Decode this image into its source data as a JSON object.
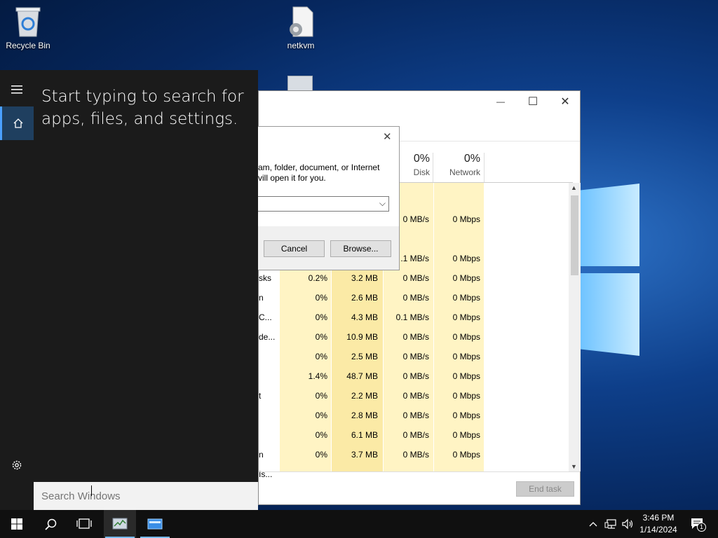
{
  "desktop": {
    "icons": [
      {
        "label": "Recycle Bin",
        "icon": "recycle-bin-icon"
      },
      {
        "label": "netkvm",
        "icon": "setup-file-icon"
      }
    ]
  },
  "start_menu": {
    "hint": "Start typing to search for apps, files, and settings.",
    "rail": [
      {
        "icon": "hamburger-menu-icon"
      },
      {
        "icon": "home-icon"
      },
      {
        "icon": "settings-gear-icon"
      }
    ],
    "search": {
      "placeholder": "Search Windows",
      "value": ""
    }
  },
  "run_dialog": {
    "description_line1": "am, folder, document, or Internet",
    "description_line2": "vill open it for you.",
    "cancel_label": "Cancel",
    "browse_label": "Browse..."
  },
  "task_manager": {
    "columns": [
      {
        "pct": "0%",
        "label": "Disk"
      },
      {
        "pct": "0%",
        "label": "Network"
      }
    ],
    "rows": [
      {
        "name": "",
        "cpu": "",
        "memory": "",
        "disk": "0 MB/s",
        "network": "0 Mbps"
      },
      {
        "name": "",
        "cpu": "",
        "memory": "",
        "disk": "",
        "network": ""
      },
      {
        "name": "",
        "cpu": "",
        "memory": "",
        "disk": ".1 MB/s",
        "network": "0 Mbps"
      },
      {
        "name": "sks",
        "cpu": "0.2%",
        "memory": "3.2 MB",
        "disk": "0 MB/s",
        "network": "0 Mbps"
      },
      {
        "name": "n C...",
        "cpu": "0%",
        "memory": "2.6 MB",
        "disk": "0 MB/s",
        "network": "0 Mbps"
      },
      {
        "name": "",
        "cpu": "0%",
        "memory": "4.3 MB",
        "disk": "0.1 MB/s",
        "network": "0 Mbps"
      },
      {
        "name": "de...",
        "cpu": "0%",
        "memory": "10.9 MB",
        "disk": "0 MB/s",
        "network": "0 Mbps"
      },
      {
        "name": "",
        "cpu": "0%",
        "memory": "2.5 MB",
        "disk": "0 MB/s",
        "network": "0 Mbps"
      },
      {
        "name": "",
        "cpu": "1.4%",
        "memory": "48.7 MB",
        "disk": "0 MB/s",
        "network": "0 Mbps"
      },
      {
        "name": "t",
        "cpu": "0%",
        "memory": "2.2 MB",
        "disk": "0 MB/s",
        "network": "0 Mbps"
      },
      {
        "name": "",
        "cpu": "0%",
        "memory": "2.8 MB",
        "disk": "0 MB/s",
        "network": "0 Mbps"
      },
      {
        "name": "",
        "cpu": "0%",
        "memory": "6.1 MB",
        "disk": "0 MB/s",
        "network": "0 Mbps"
      },
      {
        "name": "n Is...",
        "cpu": "0%",
        "memory": "3.7 MB",
        "disk": "0 MB/s",
        "network": "0 Mbps"
      }
    ],
    "end_task_label": "End task",
    "caption": {
      "minimize": "—",
      "maximize": "☐",
      "close": "✕"
    }
  },
  "taskbar": {
    "buttons": [
      {
        "icon": "windows-start-icon"
      },
      {
        "icon": "search-icon"
      },
      {
        "icon": "task-view-icon"
      },
      {
        "icon": "task-manager-app-icon"
      },
      {
        "icon": "run-app-icon"
      }
    ],
    "tray": [
      {
        "icon": "chevron-up-icon"
      },
      {
        "icon": "network-icon"
      },
      {
        "icon": "volume-icon"
      }
    ],
    "time": "3:46 PM",
    "date": "1/14/2024",
    "notification_count": "1"
  },
  "colors": {
    "accent": "#76b9ed",
    "heat_light": "#fff4c4",
    "heat_mid": "#fbeaa6"
  }
}
